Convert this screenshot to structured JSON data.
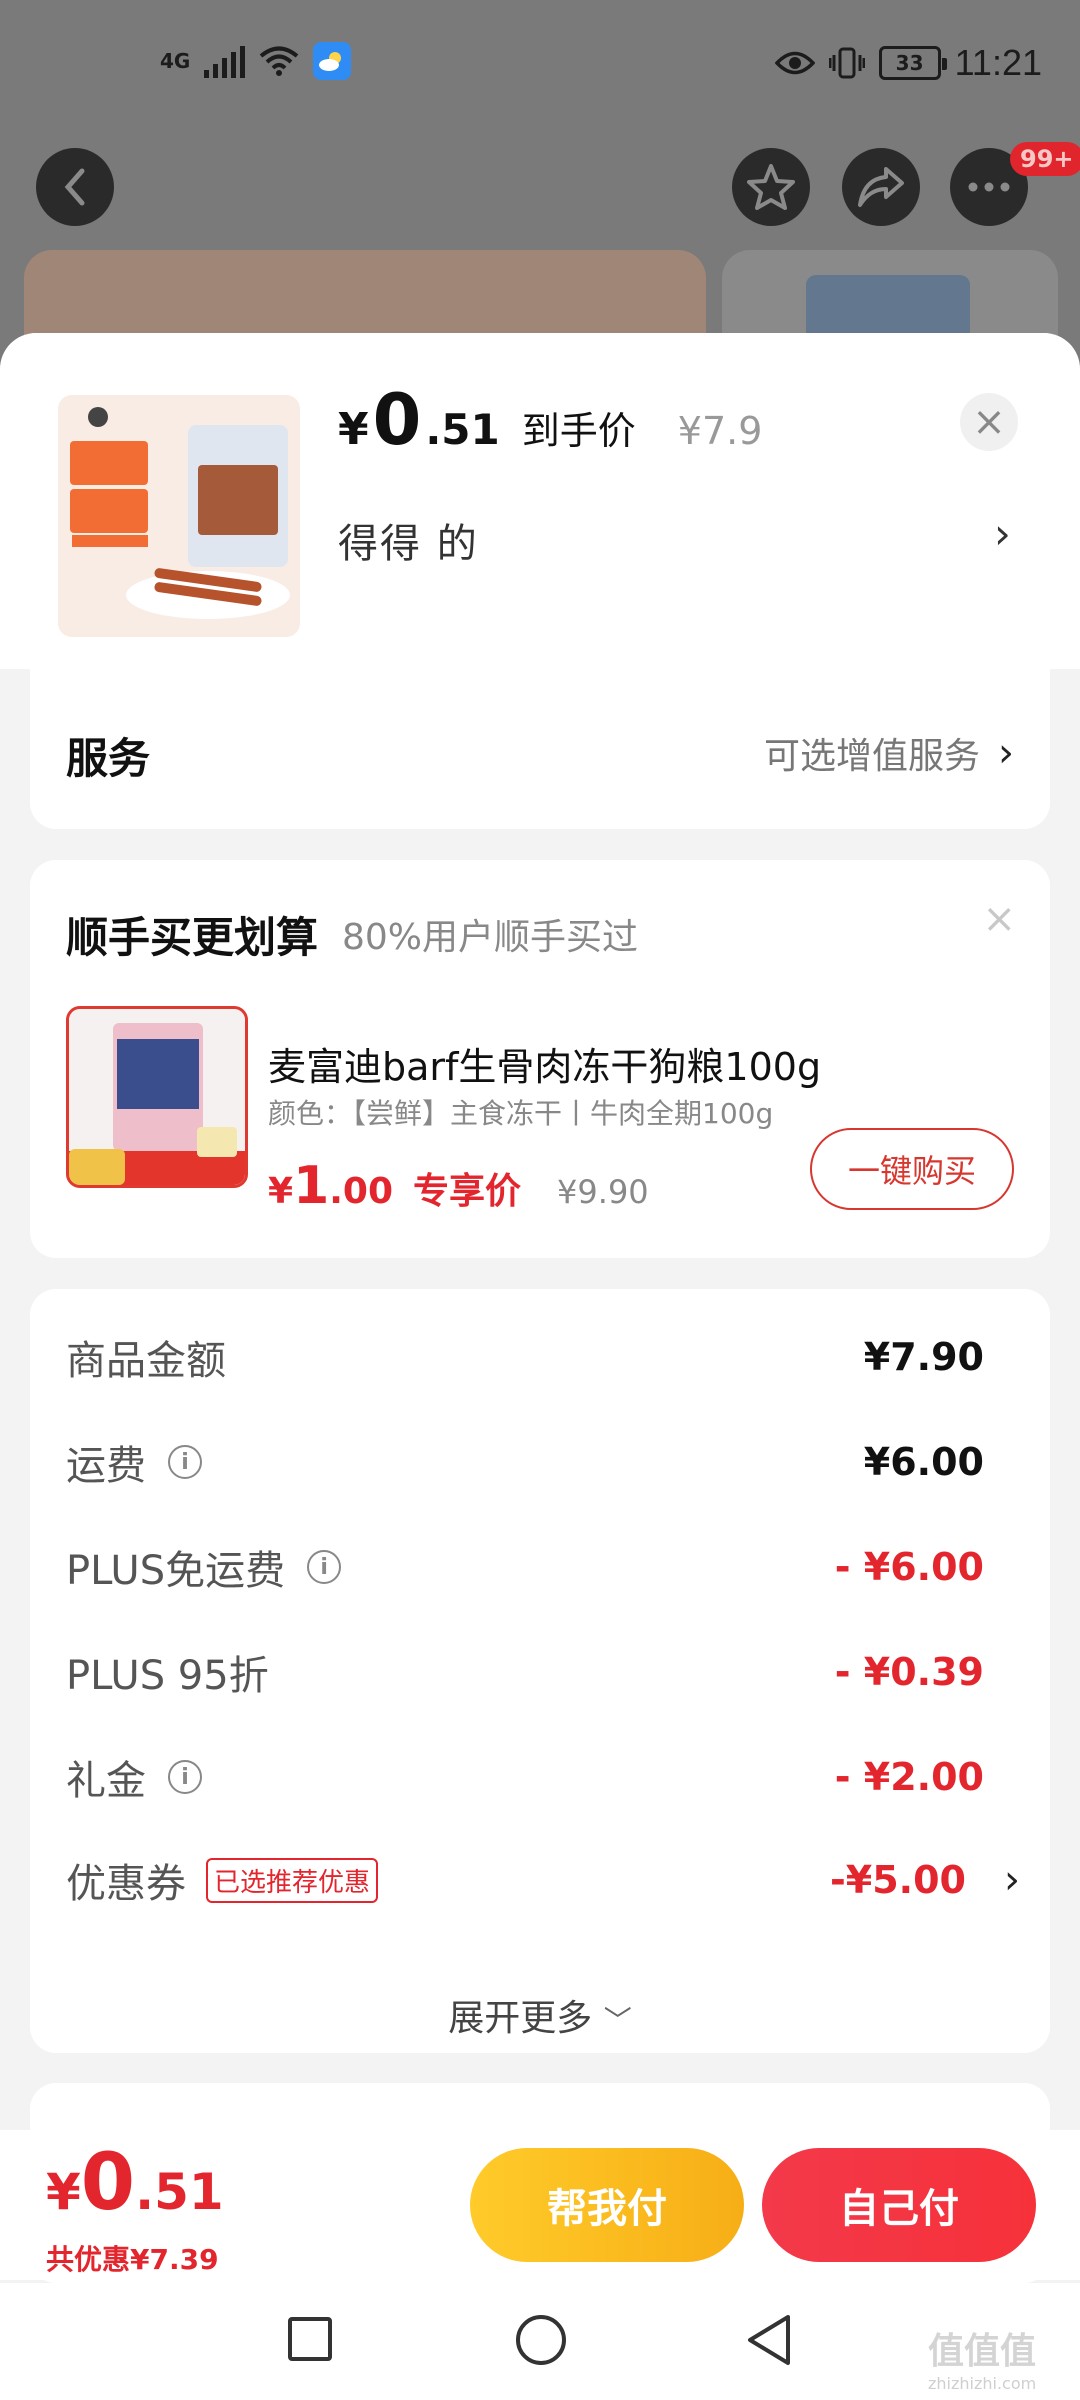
{
  "status_bar": {
    "network": "4G",
    "time": "11:21",
    "battery": "33"
  },
  "top_nav": {
    "more_badge": "99+"
  },
  "product": {
    "price_currency": "¥",
    "price_integer": "0",
    "price_decimal": ".51",
    "price_tag": "到手价",
    "original_price": "¥7.9",
    "spec": "得得 的"
  },
  "service": {
    "title": "服务",
    "right_text": "可选增值服务"
  },
  "bundle": {
    "title": "顺手买更划算",
    "subtitle": "80%用户顺手买过",
    "item_name": "麦富迪barf生骨肉冻干狗粮100g",
    "item_color": "颜色：【尝鲜】主食冻干丨牛肉全期100g",
    "price_currency": "¥",
    "price_integer": "1",
    "price_decimal": ".00",
    "price_tag": "专享价",
    "original_price": "¥9.90",
    "buy_button": "一键购买"
  },
  "summary": {
    "rows": [
      {
        "label": "商品金额",
        "value": "¥7.90"
      },
      {
        "label": "运费",
        "value": "¥6.00"
      },
      {
        "label": "PLUS免运费",
        "value": "- ¥6.00"
      },
      {
        "label": "PLUS 95折",
        "value": "- ¥0.39"
      },
      {
        "label": "礼金",
        "value": "- ¥2.00"
      },
      {
        "label": "优惠券",
        "value": "-¥5.00",
        "tag": "已选推荐优惠"
      }
    ],
    "expand_more": "展开更多"
  },
  "action_bar": {
    "total_currency": "¥",
    "total_integer": "0",
    "total_decimal": ".51",
    "saving": "共优惠¥7.39",
    "help_pay": "帮我付",
    "self_pay": "自己付"
  },
  "watermark": {
    "text": "值值值",
    "url": "zhizhizhi.com"
  }
}
